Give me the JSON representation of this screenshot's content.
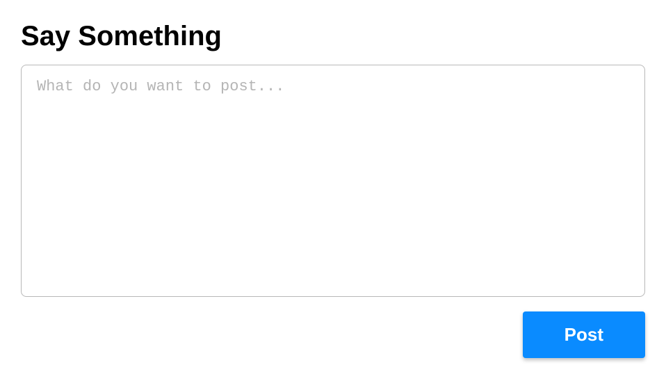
{
  "heading": "Say Something",
  "composer": {
    "placeholder": "What do you want to post...",
    "value": ""
  },
  "actions": {
    "post_label": "Post"
  }
}
